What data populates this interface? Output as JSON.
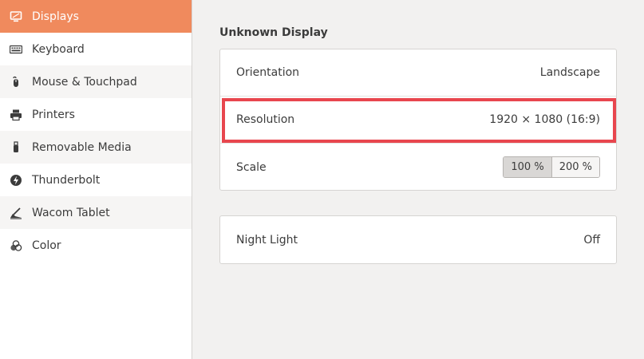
{
  "sidebar": {
    "items": [
      {
        "label": "Displays",
        "icon": "display-icon",
        "active": true
      },
      {
        "label": "Keyboard",
        "icon": "keyboard-icon"
      },
      {
        "label": "Mouse & Touchpad",
        "icon": "mouse-icon"
      },
      {
        "label": "Printers",
        "icon": "printer-icon"
      },
      {
        "label": "Removable Media",
        "icon": "usb-drive-icon"
      },
      {
        "label": "Thunderbolt",
        "icon": "thunderbolt-icon"
      },
      {
        "label": "Wacom Tablet",
        "icon": "tablet-icon"
      },
      {
        "label": "Color",
        "icon": "color-icon"
      }
    ]
  },
  "main": {
    "section_title": "Unknown Display",
    "display_settings": {
      "orientation": {
        "label": "Orientation",
        "value": "Landscape"
      },
      "resolution": {
        "label": "Resolution",
        "value": "1920 × 1080 (16:9)"
      },
      "scale": {
        "label": "Scale",
        "options": [
          "100 %",
          "200 %"
        ],
        "selected": "100 %"
      }
    },
    "night_light": {
      "label": "Night Light",
      "value": "Off"
    }
  },
  "colors": {
    "accent": "#f08a5d",
    "highlight_border": "#e8464e",
    "sidebar_bg": "#ffffff",
    "main_bg": "#f2f1f0"
  }
}
